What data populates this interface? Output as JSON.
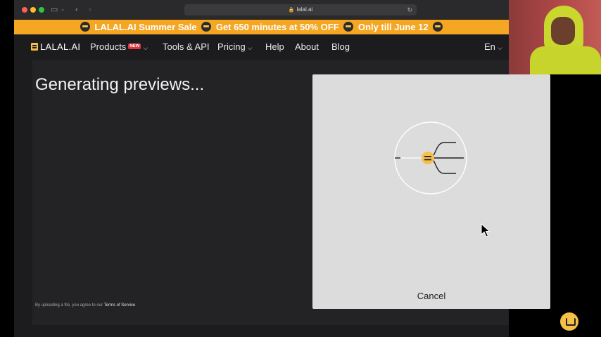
{
  "browser": {
    "url": "lalal.ai"
  },
  "banner": {
    "segments": [
      "LALAL.AI Summer Sale",
      "Get 650 minutes at 50% OFF",
      "Only till June 12"
    ]
  },
  "nav": {
    "logo": "LALAL.AI",
    "products": "Products",
    "products_badge": "NEW",
    "tools": "Tools & API",
    "pricing": "Pricing",
    "help": "Help",
    "about": "About",
    "blog": "Blog",
    "language": "En"
  },
  "main": {
    "title": "Generating previews...",
    "terms_prefix": "By uploading a file, you agree to our",
    "terms_link": "Terms of Service"
  },
  "modal": {
    "cancel_label": "Cancel"
  },
  "colors": {
    "accent": "#f5a623",
    "logo_yellow": "#f5c04a",
    "background": "#1c1c1e",
    "modal_bg": "#dcdcdc"
  },
  "icons": {
    "close": "traffic-light-close-icon",
    "sidebar": "sidebar-toggle-icon",
    "back": "chevron-left-icon",
    "forward": "chevron-right-icon",
    "lock": "lock-icon",
    "reload": "reload-icon",
    "chat": "chat-icon"
  }
}
